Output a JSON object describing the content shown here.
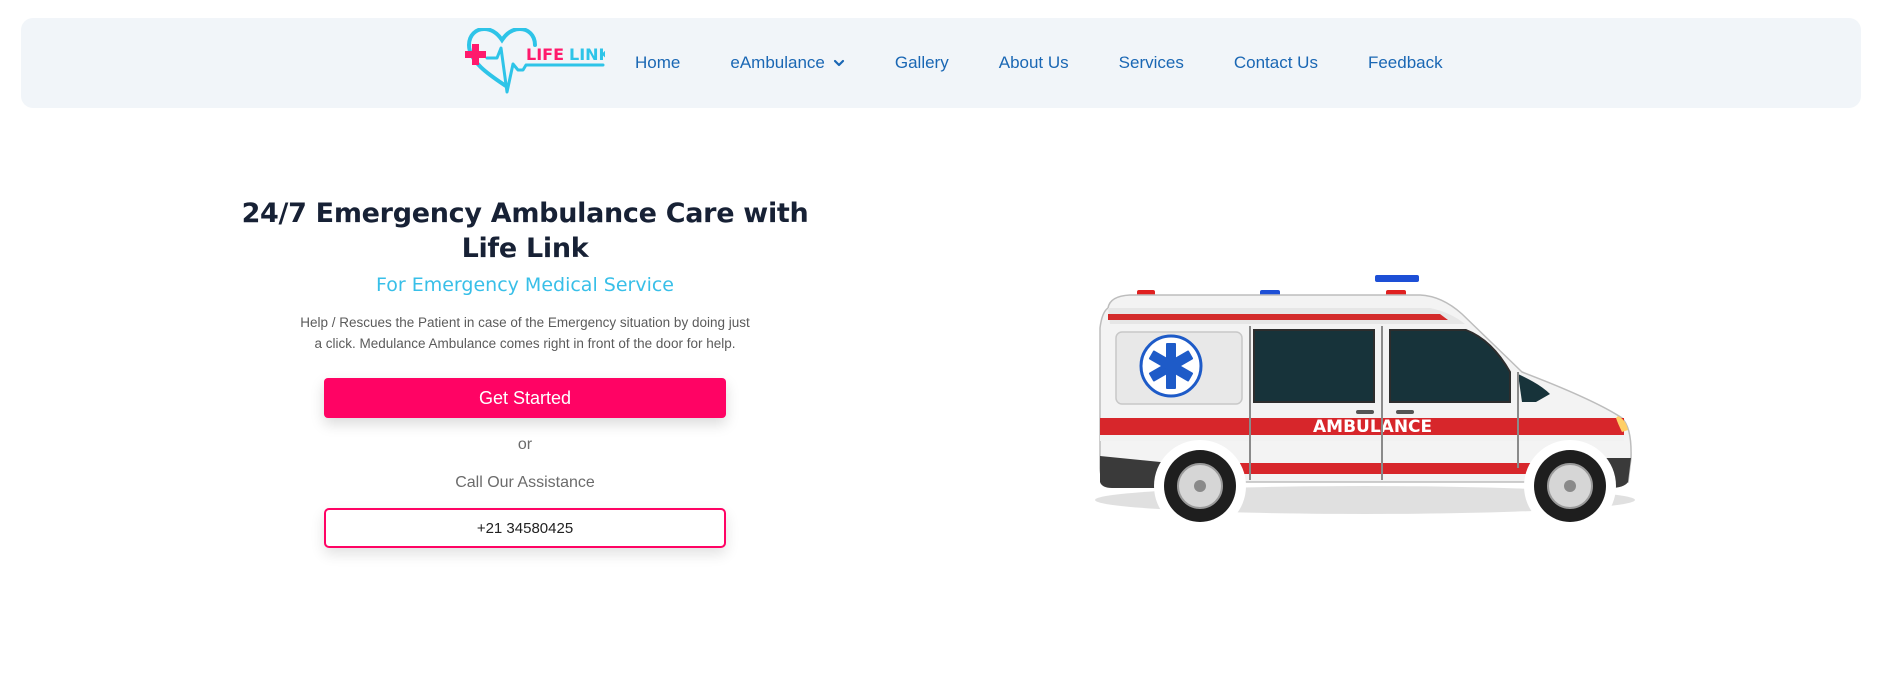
{
  "brand": {
    "logo_text_part1": "LIFE",
    "logo_text_part2": "LINK",
    "heart_color": "#2ec4e8",
    "cross_color": "#ff1a6c"
  },
  "nav": {
    "items": [
      {
        "label": "Home"
      },
      {
        "label": "eAmbulance",
        "icon": "chevron-down-icon"
      },
      {
        "label": "Gallery"
      },
      {
        "label": "About Us"
      },
      {
        "label": "Services"
      },
      {
        "label": "Contact Us"
      },
      {
        "label": "Feedback"
      }
    ],
    "link_color": "#1a67b4"
  },
  "hero": {
    "title": "24/7 Emergency Ambulance Care with Life Link",
    "subtitle": "For Emergency Medical Service",
    "description": "Help / Rescues the Patient in case of the Emergency situation by doing just a click. Medulance Ambulance comes right in front of the door for help.",
    "cta_label": "Get Started",
    "or_text": "or",
    "call_label": "Call Our Assistance",
    "phone": "+21 34580425",
    "accent_color": "#ff0364",
    "subtitle_color": "#38bfe8"
  },
  "illustration": {
    "label": "AMBULANCE",
    "icon": "star-of-life-icon"
  }
}
